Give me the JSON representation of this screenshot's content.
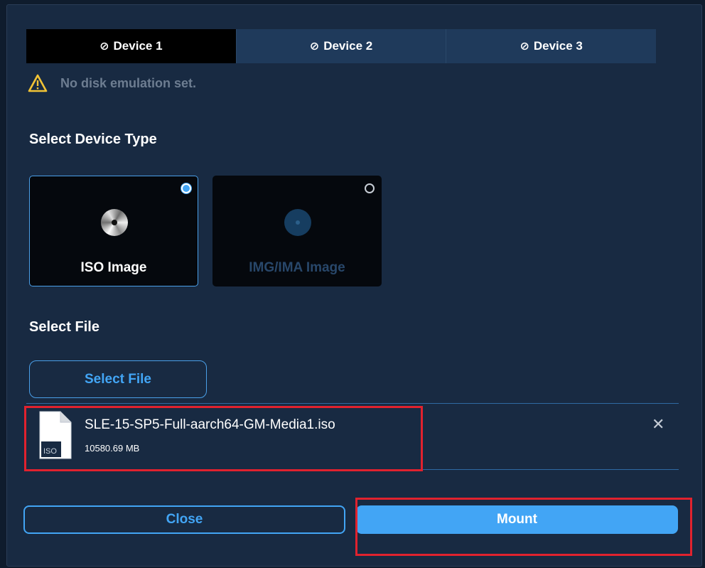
{
  "tabs": [
    {
      "label": "Device 1",
      "active": true
    },
    {
      "label": "Device 2",
      "active": false
    },
    {
      "label": "Device 3",
      "active": false
    }
  ],
  "tab_icon": "no-entry-icon",
  "warning": {
    "icon": "warning-triangle-icon",
    "text": "No disk emulation set."
  },
  "device_type": {
    "heading": "Select Device Type",
    "options": [
      {
        "label": "ISO Image",
        "selected": true,
        "icon": "cd-disc-icon"
      },
      {
        "label": "IMG/IMA Image",
        "selected": false,
        "icon": "floppy-disc-icon"
      }
    ]
  },
  "file": {
    "heading": "Select File",
    "button_label": "Select File",
    "selected": {
      "icon": "iso-file-icon",
      "icon_label": "ISO",
      "name": "SLE-15-SP5-Full-aarch64-GM-Media1.iso",
      "size": "10580.69 MB",
      "remove_symbol": "✕"
    }
  },
  "actions": {
    "close_label": "Close",
    "mount_label": "Mount"
  },
  "colors": {
    "dialog_bg": "#182a42",
    "accent": "#42a5f5",
    "active_tab": "#000000",
    "inactive_tab": "#1f3a5b",
    "warning": "#f2c335",
    "highlight": "#e0222e"
  }
}
